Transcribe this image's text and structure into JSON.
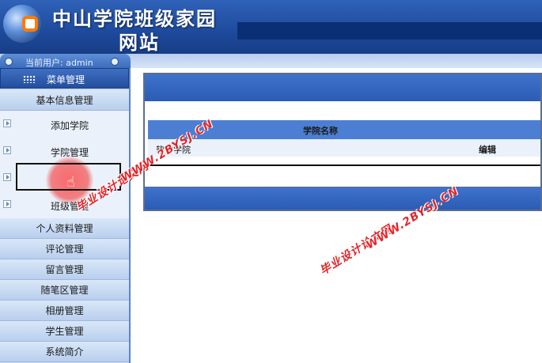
{
  "header": {
    "title_line1": "中山学院班级家园",
    "title_line2": "网站"
  },
  "user_bar": {
    "text": "当前用户: admin"
  },
  "sidebar": {
    "menu_header": "菜单管理",
    "groups": [
      {
        "label": "基本信息管理"
      },
      {
        "label": "个人资料管理"
      },
      {
        "label": "评论管理"
      },
      {
        "label": "留言管理"
      },
      {
        "label": "随笔区管理"
      },
      {
        "label": "相册管理"
      },
      {
        "label": "学生管理"
      },
      {
        "label": "系统简介"
      }
    ],
    "sub_items": [
      {
        "label": "添加学院"
      },
      {
        "label": "学院管理"
      },
      {
        "label": ""
      },
      {
        "label": "班级管理"
      }
    ]
  },
  "main": {
    "table": {
      "column_header": "学院名称",
      "rows": [
        {
          "name": "软件学院",
          "action": "编辑"
        }
      ]
    }
  },
  "watermark": {
    "text1": "毕业设计论文网",
    "text2": "WWW.2BYSJ.CN"
  },
  "colors": {
    "header_blue": "#1e4a9c",
    "accent_blue": "#3e72cc",
    "watermark_red": "#e1262a"
  }
}
